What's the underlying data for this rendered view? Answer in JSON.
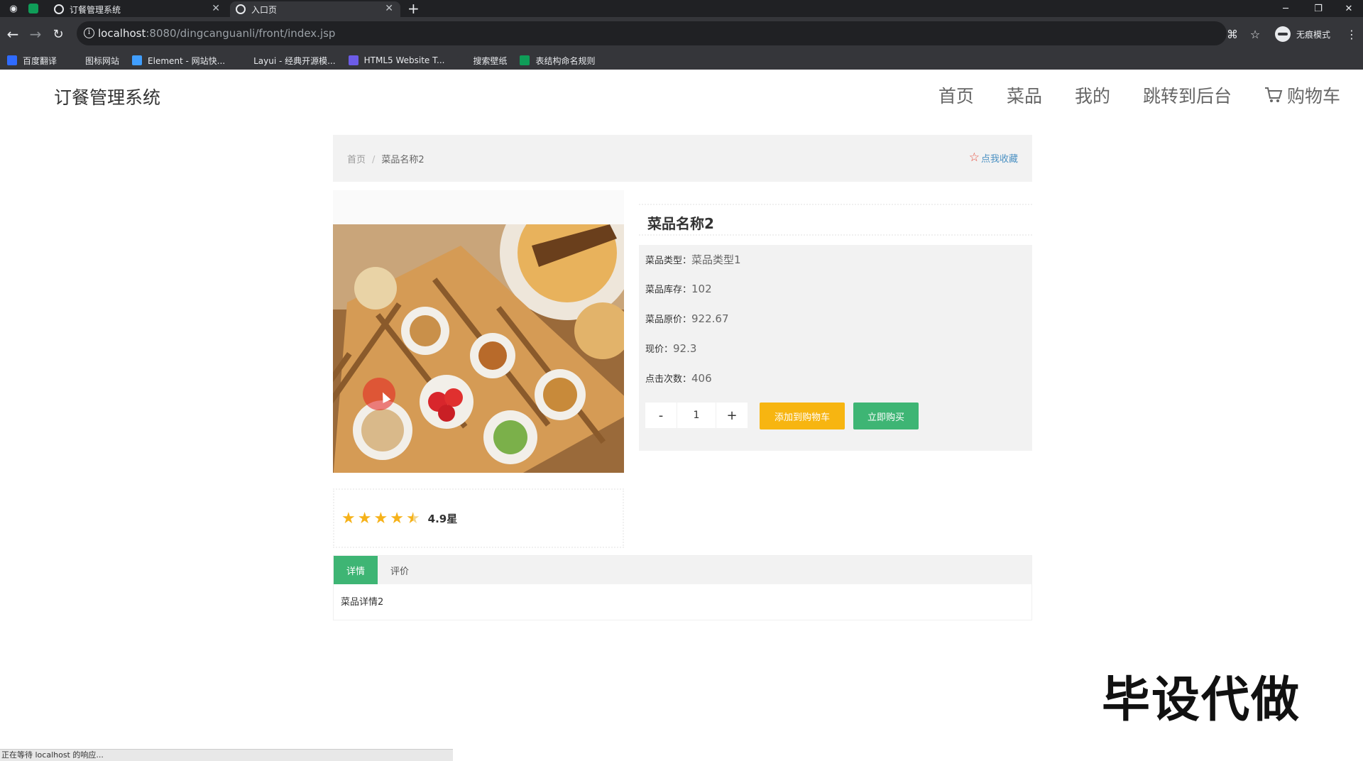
{
  "browser": {
    "tabs": [
      {
        "title": "订餐管理系统"
      },
      {
        "title": "入口页"
      }
    ],
    "url_host": "localhost",
    "url_path": ":8080/dingcanguanli/front/index.jsp",
    "incognito_label": "无痕模式",
    "bookmarks": [
      {
        "label": "百度翻译",
        "icon": "translate-icon",
        "color": "#2f6bff"
      },
      {
        "label": "图标网站",
        "icon": "flag-icon",
        "color": "#35363a"
      },
      {
        "label": "Element - 网站快...",
        "icon": "element-icon",
        "color": "#409eff"
      },
      {
        "label": "Layui - 经典开源模...",
        "icon": "layui-icon",
        "color": "#35363a"
      },
      {
        "label": "HTML5 Website T...",
        "icon": "html5-icon",
        "color": "#6c5ce7"
      },
      {
        "label": "搜索壁纸",
        "icon": "wallpaper-icon",
        "color": "#35363a"
      },
      {
        "label": "表结构命名规则",
        "icon": "sheet-icon",
        "color": "#0f9d58"
      }
    ],
    "status_text": "正在等待 localhost 的响应..."
  },
  "header": {
    "site_title": "订餐管理系统",
    "nav": [
      "首页",
      "菜品",
      "我的",
      "跳转到后台",
      "购物车"
    ]
  },
  "breadcrumb": {
    "home": "首页",
    "separator": "/",
    "current": "菜品名称2",
    "collect_label": "点我收藏"
  },
  "product": {
    "name": "菜品名称2",
    "fields": [
      {
        "label": "菜品类型：",
        "value": "菜品类型1"
      },
      {
        "label": "菜品库存：",
        "value": "102"
      },
      {
        "label": "菜品原价：",
        "value": "922.67"
      },
      {
        "label": "现价：",
        "value": "92.3"
      },
      {
        "label": "点击次数：",
        "value": "406"
      }
    ],
    "quantity": "1",
    "minus": "-",
    "plus": "+",
    "add_to_cart": "添加到购物车",
    "buy_now": "立即购买",
    "rating_stars": 4.5,
    "rating_text": "4.9星"
  },
  "tabs": {
    "items": [
      "详情",
      "评价"
    ],
    "active": 0,
    "detail_text": "菜品详情2"
  },
  "watermark": "毕设代做",
  "colors": {
    "green": "#3eb574",
    "orange": "#f7b511",
    "star": "#f6b21a"
  }
}
